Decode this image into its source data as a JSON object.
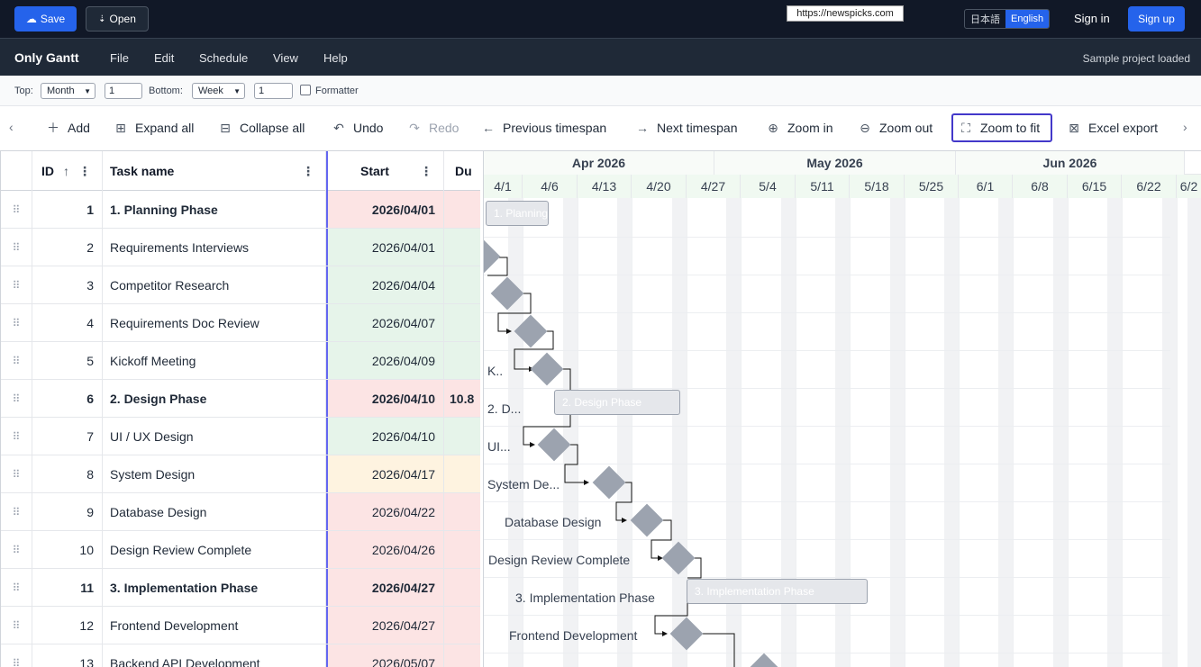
{
  "topbar": {
    "save_label": "Save",
    "open_label": "Open",
    "url_tooltip": "https://newspicks.com",
    "lang_ja": "日本語",
    "lang_en": "English",
    "signin_label": "Sign in",
    "signup_label": "Sign up"
  },
  "menubar": {
    "brand": "Only Gantt",
    "items": [
      "File",
      "Edit",
      "Schedule",
      "View",
      "Help"
    ],
    "status": "Sample project loaded"
  },
  "settings": {
    "top_label": "Top:",
    "top_unit": "Month",
    "top_count": "1",
    "bottom_label": "Bottom:",
    "bottom_unit": "Week",
    "bottom_count": "1",
    "formatter_label": "Formatter",
    "formatter_checked": false
  },
  "toolbar": {
    "add": "Add",
    "expand_all": "Expand all",
    "collapse_all": "Collapse all",
    "undo": "Undo",
    "redo": "Redo",
    "previous_timespan": "Previous timespan",
    "next_timespan": "Next timespan",
    "zoom_in": "Zoom in",
    "zoom_out": "Zoom out",
    "zoom_to_fit": "Zoom to fit",
    "excel_export": "Excel export"
  },
  "grid": {
    "headers": {
      "id": "ID",
      "name": "Task name",
      "start": "Start",
      "duration": "Du"
    },
    "rows": [
      {
        "id": "1",
        "name": "1. Planning Phase",
        "start": "2026/04/01",
        "duration": "",
        "parent": true,
        "tone": "red"
      },
      {
        "id": "2",
        "name": "Requirements Interviews",
        "start": "2026/04/01",
        "duration": "",
        "parent": false,
        "tone": "green"
      },
      {
        "id": "3",
        "name": "Competitor Research",
        "start": "2026/04/04",
        "duration": "",
        "parent": false,
        "tone": "green"
      },
      {
        "id": "4",
        "name": "Requirements Doc Review",
        "start": "2026/04/07",
        "duration": "",
        "parent": false,
        "tone": "green"
      },
      {
        "id": "5",
        "name": "Kickoff Meeting",
        "start": "2026/04/09",
        "duration": "",
        "parent": false,
        "tone": "green"
      },
      {
        "id": "6",
        "name": "2. Design Phase",
        "start": "2026/04/10",
        "duration": "10.8",
        "parent": true,
        "tone": "red"
      },
      {
        "id": "7",
        "name": "UI / UX Design",
        "start": "2026/04/10",
        "duration": "",
        "parent": false,
        "tone": "green"
      },
      {
        "id": "8",
        "name": "System Design",
        "start": "2026/04/17",
        "duration": "",
        "parent": false,
        "tone": "yellow"
      },
      {
        "id": "9",
        "name": "Database Design",
        "start": "2026/04/22",
        "duration": "",
        "parent": false,
        "tone": "red"
      },
      {
        "id": "10",
        "name": "Design Review Complete",
        "start": "2026/04/26",
        "duration": "",
        "parent": false,
        "tone": "red"
      },
      {
        "id": "11",
        "name": "3. Implementation Phase",
        "start": "2026/04/27",
        "duration": "",
        "parent": true,
        "tone": "red"
      },
      {
        "id": "12",
        "name": "Frontend Development",
        "start": "2026/04/27",
        "duration": "",
        "parent": false,
        "tone": "red"
      },
      {
        "id": "13",
        "name": "Backend API Development",
        "start": "2026/05/07",
        "duration": "",
        "parent": false,
        "tone": "red"
      }
    ]
  },
  "gantt": {
    "months": [
      "Apr 2026",
      "May 2026",
      "Jun 2026"
    ],
    "weeks": [
      "4/1",
      "4/6",
      "4/13",
      "4/20",
      "4/27",
      "5/4",
      "5/11",
      "5/18",
      "5/25",
      "6/1",
      "6/8",
      "6/15",
      "6/22",
      "6/2"
    ],
    "bars": {
      "planning": "1. Planning",
      "design": "2. Design Phase",
      "implementation": "3. Implementation Phase"
    },
    "labels": {
      "kickoff": "K..",
      "design_phase": "2. D...",
      "uiux": "UI...",
      "system": "System De...",
      "database": "Database Design",
      "review": "Design Review Complete",
      "implementation": "3. Implementation Phase",
      "frontend": "Frontend Development"
    },
    "colors": {
      "bar_fill": "#e5e7eb",
      "milestone": "#9ca3af",
      "accent": "#2563eb"
    }
  }
}
